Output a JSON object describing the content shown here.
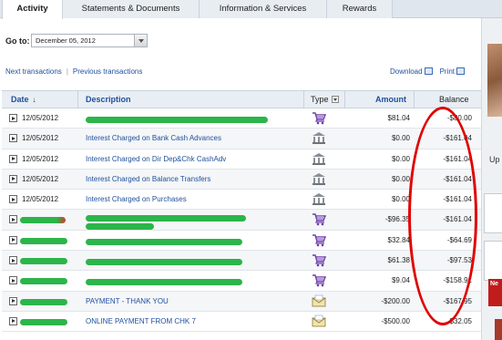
{
  "tabs": [
    {
      "label": "Activity",
      "active": true
    },
    {
      "label": "Statements & Documents",
      "active": false
    },
    {
      "label": "Information & Services",
      "active": false
    },
    {
      "label": "Rewards",
      "active": false
    }
  ],
  "goto": {
    "label": "Go to:",
    "selected": "December 05, 2012"
  },
  "nav": {
    "next": "Next transactions",
    "previous": "Previous transactions",
    "download": "Download",
    "print": "Print"
  },
  "table": {
    "headers": {
      "date": "Date",
      "description": "Description",
      "type": "Type",
      "amount": "Amount",
      "balance": "Balance"
    },
    "rows": [
      {
        "date": "12/05/2012",
        "description": "",
        "type": "purchase-cart-icon",
        "amount": "$81.04",
        "balance": "-$80.00"
      },
      {
        "date": "12/05/2012",
        "description": "Interest Charged on Bank Cash Advances",
        "type": "bank-icon",
        "amount": "$0.00",
        "balance": "-$161.04"
      },
      {
        "date": "12/05/2012",
        "description": "Interest Charged on Dir Dep&Chk CashAdv",
        "type": "bank-icon",
        "amount": "$0.00",
        "balance": "-$161.04"
      },
      {
        "date": "12/05/2012",
        "description": "Interest Charged on Balance Transfers",
        "type": "bank-icon",
        "amount": "$0.00",
        "balance": "-$161.04"
      },
      {
        "date": "12/05/2012",
        "description": "Interest Charged on Purchases",
        "type": "bank-icon",
        "amount": "$0.00",
        "balance": "-$161.04"
      },
      {
        "date": "",
        "description": "",
        "type": "purchase-cart-icon",
        "amount": "-$96.35",
        "balance": "-$161.04"
      },
      {
        "date": "",
        "description": "",
        "type": "purchase-cart-icon",
        "amount": "$32.84",
        "balance": "-$64.69"
      },
      {
        "date": "",
        "description": "",
        "type": "purchase-cart-icon",
        "amount": "$61.38",
        "balance": "-$97.53"
      },
      {
        "date": "",
        "description": "",
        "type": "purchase-cart-icon",
        "amount": "$9.04",
        "balance": "-$158.91"
      },
      {
        "date": "",
        "description": "PAYMENT - THANK YOU",
        "type": "payment-envelope-icon",
        "amount": "-$200.00",
        "balance": "-$167.95"
      },
      {
        "date": "",
        "description": "ONLINE PAYMENT FROM CHK 7",
        "type": "payment-envelope-icon",
        "amount": "-$500.00",
        "balance": "$32.05"
      }
    ]
  },
  "side": {
    "label": "Up",
    "promo": "Ne"
  },
  "colors": {
    "link": "#1f4f9c",
    "redaction": "#2bb54a",
    "annotation": "#e00000",
    "header_bg": "#e8eef4"
  }
}
